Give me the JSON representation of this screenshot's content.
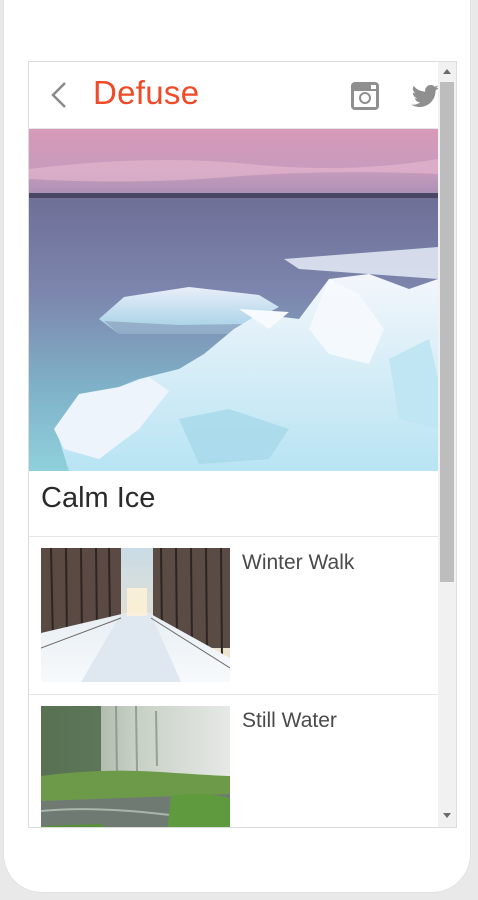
{
  "header": {
    "title": "Defuse",
    "back_icon": "chevron-left-icon",
    "social_icons": [
      "instagram-icon",
      "twitter-icon"
    ]
  },
  "hero": {
    "title": "Calm Ice"
  },
  "items": [
    {
      "label": "Winter Walk"
    },
    {
      "label": "Still Water"
    }
  ],
  "colors": {
    "brand": "#f04a28",
    "icon_gray": "#8a8a8a"
  }
}
